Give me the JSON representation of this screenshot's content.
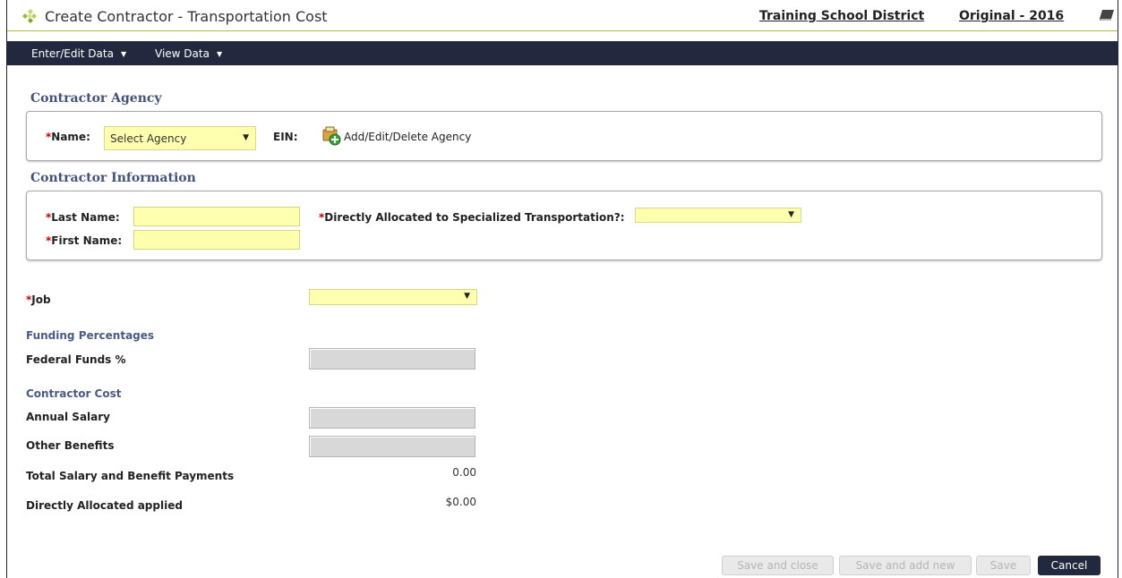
{
  "header": {
    "title": "Create Contractor - Transportation Cost",
    "district": "Training School District",
    "version": "Original - 2016",
    "logo_icon": "diamond-cluster-logo-icon",
    "help_icon": "book-icon",
    "accent_color": "#a8c040"
  },
  "nav": {
    "items": [
      {
        "label": "Enter/Edit Data",
        "caret": "▼"
      },
      {
        "label": "View Data",
        "caret": "▼"
      }
    ],
    "background": "#23283f"
  },
  "contractor_agency": {
    "title": "Contractor Agency",
    "name_required": "*",
    "name_label": "Name:",
    "name_value": "Select Agency",
    "ein_label": "EIN:",
    "agency_link": "Add/Edit/Delete Agency",
    "agency_icon": "add-agency-icon"
  },
  "contractor_info": {
    "title": "Contractor Information",
    "last_name_required": "*",
    "last_name_label": "Last Name:",
    "last_name_value": "",
    "first_name_required": "*",
    "first_name_label": "First Name:",
    "first_name_value": "",
    "allocated_required": "*",
    "allocated_label": "Directly Allocated to Specialized Transportation?:",
    "allocated_value": ""
  },
  "job": {
    "required": "*",
    "label": "Job",
    "value": ""
  },
  "funding": {
    "title": "Funding Percentages",
    "federal_label": "Federal Funds %"
  },
  "cost": {
    "title": "Contractor Cost",
    "annual_salary_label": "Annual Salary",
    "other_benefits_label": "Other Benefits",
    "total_label": "Total Salary and Benefit Payments",
    "total_value": "0.00",
    "allocated_label": "Directly Allocated applied",
    "allocated_value": "$0.00"
  },
  "buttons": {
    "save_close": "Save and close",
    "save_add_new": "Save and add new",
    "save": "Save",
    "cancel": "Cancel"
  },
  "colors": {
    "required": "#c00000",
    "field_fill": "#ffffb0",
    "section_title": "#44527a"
  }
}
